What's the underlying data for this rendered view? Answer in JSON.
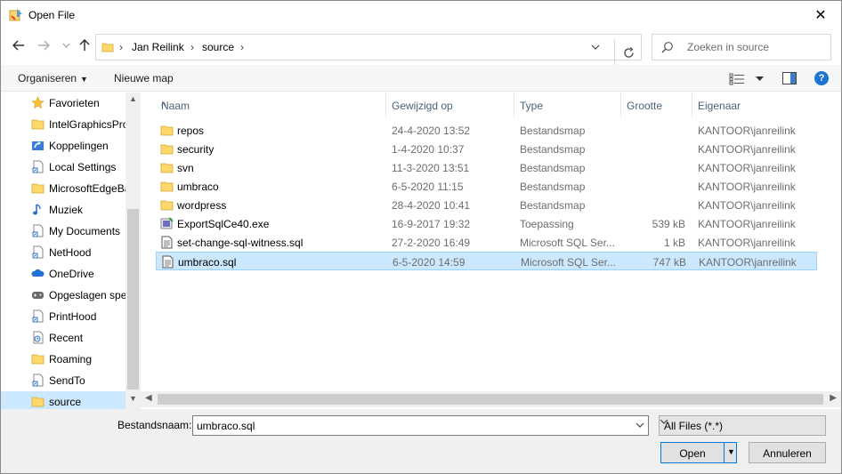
{
  "window": {
    "title": "Open File",
    "close_label": "✕"
  },
  "navigation": {
    "breadcrumb": [
      "Jan Reilink",
      "source"
    ],
    "search_placeholder": "Zoeken in source"
  },
  "toolbar": {
    "organize_label": "Organiseren",
    "new_folder_label": "Nieuwe map",
    "help_label": "?"
  },
  "sidebar": {
    "items": [
      {
        "label": "Favorieten",
        "icon": "star-icon",
        "selected": false
      },
      {
        "label": "IntelGraphicsProfiles",
        "icon": "folder-icon",
        "selected": false
      },
      {
        "label": "Koppelingen",
        "icon": "link-icon",
        "selected": false
      },
      {
        "label": "Local Settings",
        "icon": "shortcut-icon",
        "selected": false
      },
      {
        "label": "MicrosoftEdgeBackups",
        "icon": "folder-icon",
        "selected": false
      },
      {
        "label": "Muziek",
        "icon": "music-icon",
        "selected": false
      },
      {
        "label": "My Documents",
        "icon": "shortcut-icon",
        "selected": false
      },
      {
        "label": "NetHood",
        "icon": "shortcut-icon",
        "selected": false
      },
      {
        "label": "OneDrive",
        "icon": "cloud-icon",
        "selected": false
      },
      {
        "label": "Opgeslagen spellen",
        "icon": "games-icon",
        "selected": false
      },
      {
        "label": "PrintHood",
        "icon": "shortcut-icon",
        "selected": false
      },
      {
        "label": "Recent",
        "icon": "recent-icon",
        "selected": false
      },
      {
        "label": "Roaming",
        "icon": "folder-icon",
        "selected": false
      },
      {
        "label": "SendTo",
        "icon": "shortcut-icon",
        "selected": false
      },
      {
        "label": "source",
        "icon": "folder-icon",
        "selected": true
      }
    ]
  },
  "columns": {
    "name": "Naam",
    "modified": "Gewijzigd op",
    "type": "Type",
    "size": "Grootte",
    "owner": "Eigenaar"
  },
  "files": [
    {
      "name": "repos",
      "modified": "24-4-2020 13:52",
      "type": "Bestandsmap",
      "size": "",
      "owner": "KANTOOR\\janreilink",
      "icon": "folder-icon",
      "selected": false
    },
    {
      "name": "security",
      "modified": "1-4-2020 10:37",
      "type": "Bestandsmap",
      "size": "",
      "owner": "KANTOOR\\janreilink",
      "icon": "folder-icon",
      "selected": false
    },
    {
      "name": "svn",
      "modified": "11-3-2020 13:51",
      "type": "Bestandsmap",
      "size": "",
      "owner": "KANTOOR\\janreilink",
      "icon": "folder-icon",
      "selected": false
    },
    {
      "name": "umbraco",
      "modified": "6-5-2020 11:15",
      "type": "Bestandsmap",
      "size": "",
      "owner": "KANTOOR\\janreilink",
      "icon": "folder-icon",
      "selected": false
    },
    {
      "name": "wordpress",
      "modified": "28-4-2020 10:41",
      "type": "Bestandsmap",
      "size": "",
      "owner": "KANTOOR\\janreilink",
      "icon": "folder-icon",
      "selected": false
    },
    {
      "name": "ExportSqlCe40.exe",
      "modified": "16-9-2017 19:32",
      "type": "Toepassing",
      "size": "539 kB",
      "owner": "KANTOOR\\janreilink",
      "icon": "exe-icon",
      "selected": false
    },
    {
      "name": "set-change-sql-witness.sql",
      "modified": "27-2-2020 16:49",
      "type": "Microsoft SQL Ser...",
      "size": "1 kB",
      "owner": "KANTOOR\\janreilink",
      "icon": "sql-file-icon",
      "selected": false
    },
    {
      "name": "umbraco.sql",
      "modified": "6-5-2020 14:59",
      "type": "Microsoft SQL Ser...",
      "size": "747 kB",
      "owner": "KANTOOR\\janreilink",
      "icon": "sql-file-icon",
      "selected": true
    }
  ],
  "footer": {
    "filename_label": "Bestandsnaam:",
    "filename_value": "umbraco.sql",
    "filter_value": "All Files (*.*)",
    "open_label": "Open",
    "cancel_label": "Annuleren"
  },
  "colors": {
    "selection": "#cce8ff",
    "selection_border": "#99d1ff",
    "accent": "#0078d7",
    "folder": "#ffd86a"
  }
}
